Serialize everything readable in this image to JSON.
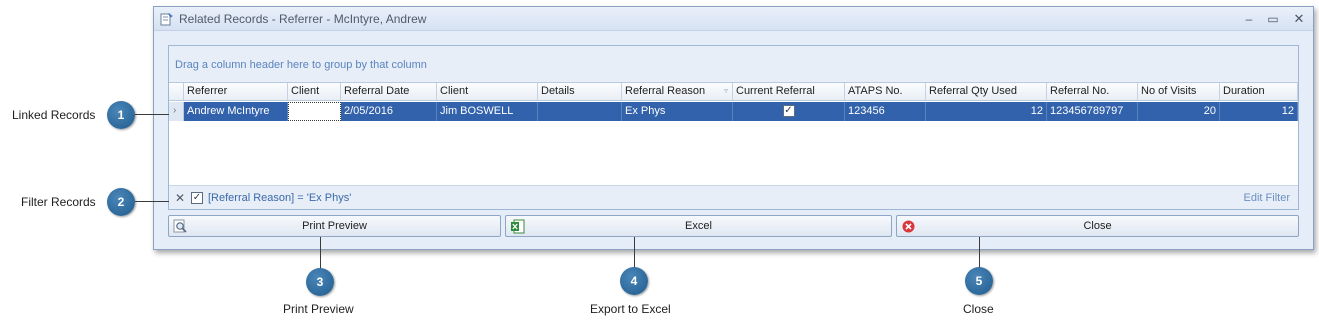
{
  "window": {
    "title": "Related Records - Referrer - McIntyre, Andrew",
    "minimize_glyph": "–",
    "maximize_glyph": "▭",
    "close_glyph": "✕"
  },
  "grid": {
    "group_hint": "Drag a column header here to group by that column",
    "columns": [
      "Referrer",
      "Client",
      "Referral Date",
      "Client",
      "Details",
      "Referral Reason",
      "Current Referral",
      "ATAPS No.",
      "Referral Qty Used",
      "Referral No.",
      "No of Visits",
      "Duration"
    ],
    "row": {
      "indicator": "›",
      "referrer": "Andrew McIntyre",
      "client_1": "",
      "referral_date": "2/05/2016",
      "client_2": "Jim BOSWELL",
      "details": "",
      "referral_reason": "Ex Phys",
      "current_referral_checked": true,
      "current_referral_glyph": "✓",
      "ataps_no": "123456",
      "referral_qty_used": "12",
      "referral_no": "123456789797",
      "no_of_visits": "20",
      "duration": "12"
    },
    "filter_bar": {
      "clear_glyph": "✕",
      "check_glyph": "✓",
      "expression": "[Referral Reason] = 'Ex Phys'",
      "edit_label": "Edit Filter"
    }
  },
  "buttons": {
    "print_preview": "Print Preview",
    "excel": "Excel",
    "close": "Close"
  },
  "callouts": [
    {
      "number": "1",
      "label": "Linked Records"
    },
    {
      "number": "2",
      "label": "Filter Records"
    },
    {
      "number": "3",
      "label": "Print Preview"
    },
    {
      "number": "4",
      "label": "Export to Excel"
    },
    {
      "number": "5",
      "label": "Close"
    }
  ],
  "icons": {
    "window": "related-records-icon",
    "print_preview": "magnifier-page-icon",
    "excel": "excel-icon",
    "close": "red-x-icon"
  },
  "colors": {
    "selected_row": "#3262ab",
    "callout": "#2a6597",
    "accent_text": "#5a84bd"
  }
}
